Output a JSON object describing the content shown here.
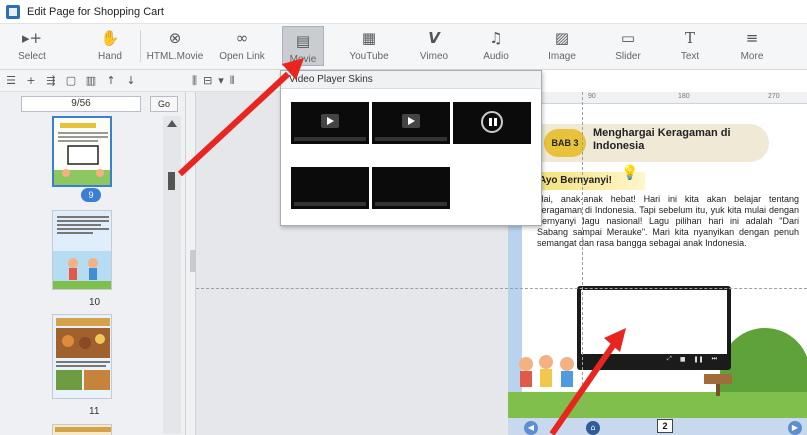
{
  "window": {
    "title": "Edit Page for Shopping Cart"
  },
  "ribbon": {
    "buttons": [
      {
        "label": "Select",
        "icon": "select-icon",
        "glyph": "▸+"
      },
      {
        "label": "Hand",
        "icon": "hand-icon",
        "glyph": "✋"
      },
      {
        "label": "HTML.Movie",
        "icon": "html-movie-icon",
        "glyph": "⊗"
      },
      {
        "label": "Open Link",
        "icon": "link-icon",
        "glyph": "∞"
      },
      {
        "label": "Movie",
        "icon": "movie-icon",
        "glyph": "▤"
      },
      {
        "label": "YouTube",
        "icon": "youtube-icon",
        "glyph": "▦"
      },
      {
        "label": "Vimeo",
        "icon": "vimeo-icon",
        "glyph": "V"
      },
      {
        "label": "Audio",
        "icon": "audio-icon",
        "glyph": "♫"
      },
      {
        "label": "Image",
        "icon": "image-icon",
        "glyph": "▨"
      },
      {
        "label": "Slider",
        "icon": "slider-icon",
        "glyph": "▭"
      },
      {
        "label": "Text",
        "icon": "text-icon",
        "glyph": "T"
      },
      {
        "label": "More",
        "icon": "more-icon",
        "glyph": "≡"
      }
    ],
    "active": "Movie"
  },
  "sidebar": {
    "page_input": "9/56",
    "go_label": "Go",
    "current_badge": "9",
    "page_labels": [
      "10",
      "11"
    ]
  },
  "popup": {
    "title": "Video Player Skins"
  },
  "book": {
    "chapter_tag": "BAB 3",
    "chapter_title": "Menghargai Keragaman di Indonesia",
    "section": "Ayo Bernyanyi!",
    "paragraph": "Hai, anak-anak hebat! Hari ini kita akan belajar tentang keragaman di Indonesia. Tapi sebelum itu, yuk kita mulai dengan bernyanyi lagu nasional! Lagu pilihan hari ini adalah \"Dari Sabang sampai Merauke\". Mari kita nyanyikan dengan penuh semangat dan rasa bangga sebagai anak Indonesia.",
    "page_number": "2"
  },
  "ruler": {
    "marks": [
      "90",
      "180",
      "270"
    ]
  },
  "colors": {
    "arrow": "#e8251e",
    "selection": "#3a7fd1",
    "book_border": "#b9d3ef"
  }
}
